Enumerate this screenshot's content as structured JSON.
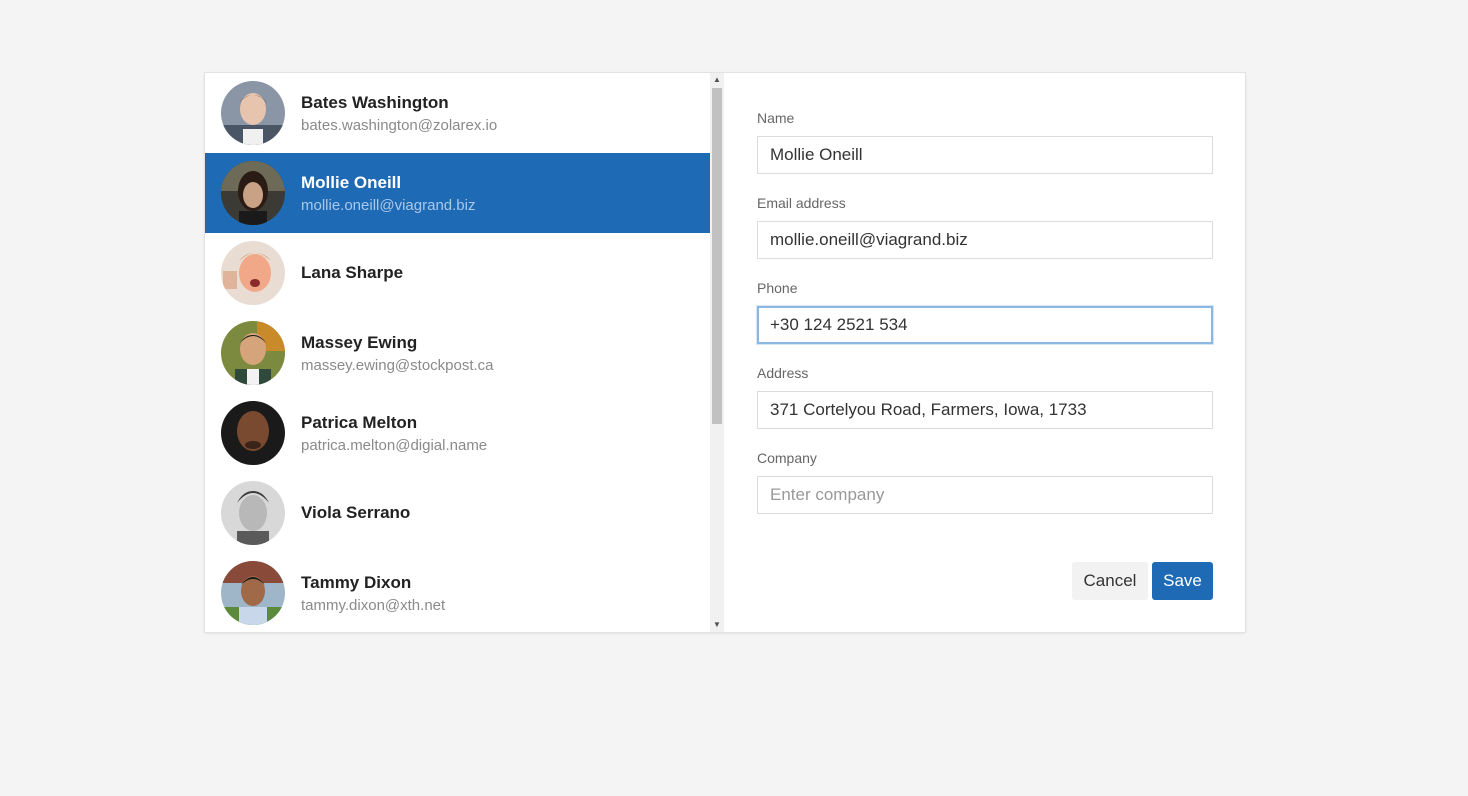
{
  "contacts": [
    {
      "name": "Bates Washington",
      "email": "bates.washington@zolarex.io",
      "selected": false
    },
    {
      "name": "Mollie Oneill",
      "email": "mollie.oneill@viagrand.biz",
      "selected": true
    },
    {
      "name": "Lana Sharpe",
      "email": "",
      "selected": false
    },
    {
      "name": "Massey Ewing",
      "email": "massey.ewing@stockpost.ca",
      "selected": false
    },
    {
      "name": "Patrica Melton",
      "email": "patrica.melton@digial.name",
      "selected": false
    },
    {
      "name": "Viola Serrano",
      "email": "",
      "selected": false
    },
    {
      "name": "Tammy Dixon",
      "email": "tammy.dixon@xth.net",
      "selected": false
    }
  ],
  "form": {
    "name": {
      "label": "Name",
      "value": "Mollie Oneill"
    },
    "email": {
      "label": "Email address",
      "value": "mollie.oneill@viagrand.biz"
    },
    "phone": {
      "label": "Phone",
      "value": "+30 124 2521 534"
    },
    "address": {
      "label": "Address",
      "value": "371 Cortelyou Road, Farmers, Iowa, 1733"
    },
    "company": {
      "label": "Company",
      "value": "",
      "placeholder": "Enter company"
    }
  },
  "buttons": {
    "cancel": "Cancel",
    "save": "Save"
  },
  "scrollbar": {
    "up_arrow": "▲",
    "down_arrow": "▼"
  },
  "colors": {
    "accent": "#1f6ab4",
    "background": "#f4f4f4",
    "focus_border": "#8cb7e0"
  },
  "icons": {
    "avatar": "avatar-photo",
    "scroll_up": "triangle-up-icon",
    "scroll_down": "triangle-down-icon"
  }
}
